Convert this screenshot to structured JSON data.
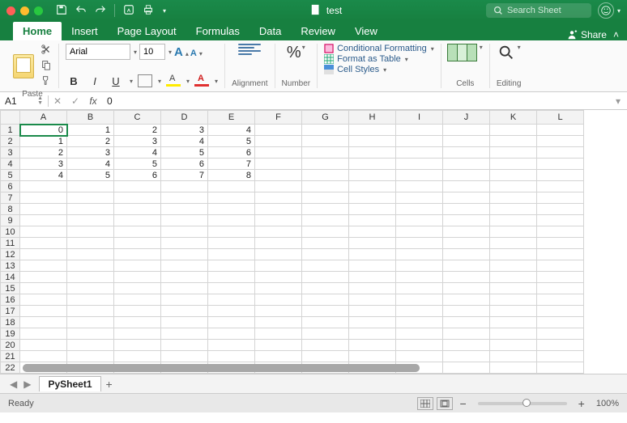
{
  "title": {
    "filename": "test"
  },
  "search": {
    "placeholder": "Search Sheet"
  },
  "share": {
    "label": "Share"
  },
  "tabs": [
    "Home",
    "Insert",
    "Page Layout",
    "Formulas",
    "Data",
    "Review",
    "View"
  ],
  "active_tab": "Home",
  "ribbon": {
    "paste_label": "Paste",
    "font_name": "Arial",
    "font_size": "10",
    "alignment_label": "Alignment",
    "number_label": "Number",
    "percent_symbol": "%",
    "cond_fmt": "Conditional Formatting",
    "fmt_table": "Format as Table",
    "cell_styles": "Cell Styles",
    "cells_label": "Cells",
    "editing_label": "Editing"
  },
  "formula_bar": {
    "cell_ref": "A1",
    "fx": "fx",
    "value": "0"
  },
  "columns": [
    "A",
    "B",
    "C",
    "D",
    "E",
    "F",
    "G",
    "H",
    "I",
    "J",
    "K",
    "L"
  ],
  "row_count": 25,
  "selected_cell": "A1",
  "cell_data": {
    "1": [
      "0",
      "1",
      "2",
      "3",
      "4"
    ],
    "2": [
      "1",
      "2",
      "3",
      "4",
      "5"
    ],
    "3": [
      "2",
      "3",
      "4",
      "5",
      "6"
    ],
    "4": [
      "3",
      "4",
      "5",
      "6",
      "7"
    ],
    "5": [
      "4",
      "5",
      "6",
      "7",
      "8"
    ]
  },
  "sheet_tabs": {
    "active": "PySheet1"
  },
  "status": {
    "ready": "Ready",
    "zoom": "100%"
  }
}
